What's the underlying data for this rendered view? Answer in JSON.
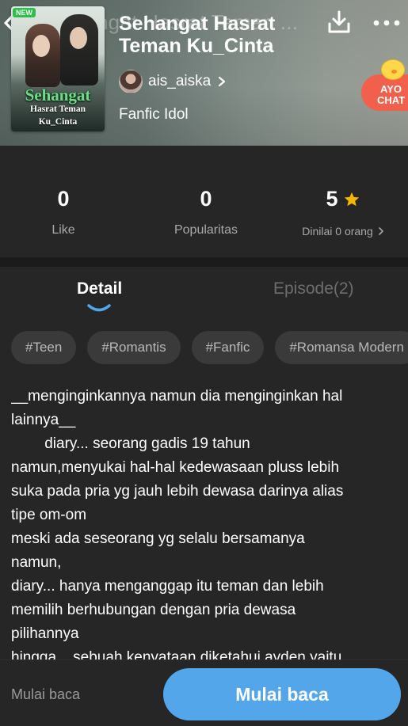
{
  "header": {
    "ghost_title": "Sehangat Hasrat Teman ...",
    "title": "Sehangat Hasrat Teman Ku_Cinta",
    "author": "ais_aiska",
    "genre": "Fanfic Idol",
    "cover": {
      "badge": "NEW",
      "author": "ais_aiska",
      "title_line1": "Sehangat",
      "title_line2": "Hasrat Teman",
      "title_line3": "Ku_Cinta"
    },
    "ayo_chat": {
      "line1": "AYO",
      "line2": "CHAT"
    }
  },
  "stats": {
    "likes": {
      "value": "0",
      "label": "Like"
    },
    "popularity": {
      "value": "0",
      "label": "Popularitas"
    },
    "rating": {
      "value": "5",
      "label": "Dinilai 0 orang"
    }
  },
  "tabs": {
    "detail": "Detail",
    "episode": "Episode(2)"
  },
  "tags": [
    "#Teen",
    "#Romantis",
    "#Fanfic",
    "#Romansa Modern"
  ],
  "synopsis": {
    "lines": [
      "__menginginkannya namun dia menginginkan hal",
      "lainnya__",
      "        diary... seorang gadis 19 tahun",
      "namun,menyukai hal-hal kedewasaan pluss lebih",
      "suka pada pria yg jauh lebih dewasa darinya alias",
      "tipe om-om",
      "meski ada seseorang yg selalu bersamanya",
      "namun,",
      "diary... hanya menganggap itu teman dan lebih",
      "memilih berhubungan dengan pria dewasa",
      "pilihannya",
      "hingga... sebuah kenyataan diketahui ayden yaitu"
    ]
  },
  "bottom_bar": {
    "link_label": "Mulai baca",
    "cta_label": "Mulai baca"
  },
  "colors": {
    "accent": "#53a6ea",
    "star": "#f5b800",
    "chat_bubble": "#f0604c",
    "background": "#262626"
  }
}
